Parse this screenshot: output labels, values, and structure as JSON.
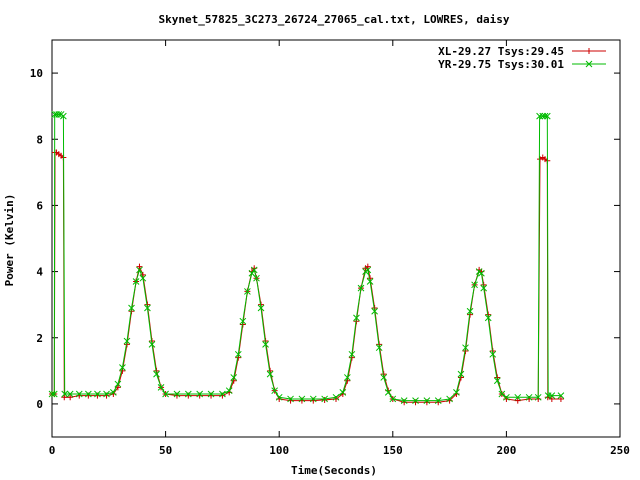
{
  "chart_data": {
    "type": "line",
    "title": "Skynet_57825_3C273_26724_27065_cal.txt, LOWRES, daisy",
    "xlabel": "Time(Seconds)",
    "ylabel": "Power (Kelvin)",
    "xlim": [
      0,
      250
    ],
    "ylim": [
      -1,
      11
    ],
    "xticks": [
      0,
      50,
      100,
      150,
      200,
      250
    ],
    "yticks": [
      0,
      2,
      4,
      6,
      8,
      10
    ],
    "grid": false,
    "legend_position": "top-right",
    "series": [
      {
        "name": "XL-29.27 Tsys:29.45",
        "color": "#cc0000",
        "marker": "plus",
        "points": [
          [
            0,
            0.3
          ],
          [
            1,
            0.3
          ],
          [
            1.3,
            7.6
          ],
          [
            2,
            7.6
          ],
          [
            3,
            7.55
          ],
          [
            4,
            7.5
          ],
          [
            5,
            7.45
          ],
          [
            5.4,
            0.2
          ],
          [
            8,
            0.2
          ],
          [
            12,
            0.25
          ],
          [
            16,
            0.25
          ],
          [
            20,
            0.25
          ],
          [
            24,
            0.25
          ],
          [
            27,
            0.3
          ],
          [
            29,
            0.5
          ],
          [
            31,
            1.0
          ],
          [
            33,
            1.8
          ],
          [
            35,
            2.8
          ],
          [
            37,
            3.7
          ],
          [
            38.5,
            4.15
          ],
          [
            40,
            3.9
          ],
          [
            42,
            3.0
          ],
          [
            44,
            1.9
          ],
          [
            46,
            1.0
          ],
          [
            48,
            0.5
          ],
          [
            50,
            0.3
          ],
          [
            55,
            0.25
          ],
          [
            60,
            0.25
          ],
          [
            65,
            0.25
          ],
          [
            70,
            0.25
          ],
          [
            75,
            0.25
          ],
          [
            78,
            0.35
          ],
          [
            80,
            0.7
          ],
          [
            82,
            1.4
          ],
          [
            84,
            2.4
          ],
          [
            86,
            3.4
          ],
          [
            88,
            4.0
          ],
          [
            89,
            4.1
          ],
          [
            90,
            3.8
          ],
          [
            92,
            3.0
          ],
          [
            94,
            1.9
          ],
          [
            96,
            1.0
          ],
          [
            98,
            0.4
          ],
          [
            100,
            0.15
          ],
          [
            105,
            0.1
          ],
          [
            110,
            0.1
          ],
          [
            115,
            0.1
          ],
          [
            120,
            0.12
          ],
          [
            125,
            0.15
          ],
          [
            128,
            0.3
          ],
          [
            130,
            0.7
          ],
          [
            132,
            1.4
          ],
          [
            134,
            2.5
          ],
          [
            136,
            3.5
          ],
          [
            138,
            4.1
          ],
          [
            139,
            4.15
          ],
          [
            140,
            3.8
          ],
          [
            142,
            2.9
          ],
          [
            144,
            1.8
          ],
          [
            146,
            0.9
          ],
          [
            148,
            0.4
          ],
          [
            150,
            0.15
          ],
          [
            155,
            0.05
          ],
          [
            160,
            0.05
          ],
          [
            165,
            0.05
          ],
          [
            170,
            0.05
          ],
          [
            175,
            0.1
          ],
          [
            178,
            0.3
          ],
          [
            180,
            0.8
          ],
          [
            182,
            1.6
          ],
          [
            184,
            2.7
          ],
          [
            186,
            3.6
          ],
          [
            188,
            4.05
          ],
          [
            189,
            4.0
          ],
          [
            190,
            3.6
          ],
          [
            192,
            2.7
          ],
          [
            194,
            1.6
          ],
          [
            196,
            0.8
          ],
          [
            198,
            0.3
          ],
          [
            200,
            0.15
          ],
          [
            205,
            0.1
          ],
          [
            210,
            0.15
          ],
          [
            214,
            0.15
          ],
          [
            214.8,
            7.4
          ],
          [
            216,
            7.45
          ],
          [
            217,
            7.4
          ],
          [
            218,
            7.35
          ],
          [
            218.2,
            0.2
          ],
          [
            220,
            0.15
          ],
          [
            224,
            0.15
          ]
        ]
      },
      {
        "name": "YR-29.75 Tsys:30.01",
        "color": "#00bb00",
        "marker": "cross",
        "points": [
          [
            0,
            0.3
          ],
          [
            1,
            0.3
          ],
          [
            1.2,
            8.75
          ],
          [
            2,
            8.75
          ],
          [
            3,
            8.75
          ],
          [
            4,
            8.75
          ],
          [
            5,
            8.7
          ],
          [
            5.6,
            0.3
          ],
          [
            8,
            0.3
          ],
          [
            12,
            0.3
          ],
          [
            16,
            0.3
          ],
          [
            20,
            0.3
          ],
          [
            24,
            0.3
          ],
          [
            27,
            0.35
          ],
          [
            29,
            0.6
          ],
          [
            31,
            1.1
          ],
          [
            33,
            1.9
          ],
          [
            35,
            2.9
          ],
          [
            37,
            3.7
          ],
          [
            38.5,
            4.05
          ],
          [
            40,
            3.8
          ],
          [
            42,
            2.9
          ],
          [
            44,
            1.8
          ],
          [
            46,
            0.9
          ],
          [
            48,
            0.5
          ],
          [
            50,
            0.3
          ],
          [
            55,
            0.3
          ],
          [
            60,
            0.3
          ],
          [
            65,
            0.3
          ],
          [
            70,
            0.3
          ],
          [
            75,
            0.3
          ],
          [
            78,
            0.4
          ],
          [
            80,
            0.8
          ],
          [
            82,
            1.5
          ],
          [
            84,
            2.5
          ],
          [
            86,
            3.4
          ],
          [
            88,
            3.95
          ],
          [
            89,
            4.05
          ],
          [
            90,
            3.8
          ],
          [
            92,
            2.9
          ],
          [
            94,
            1.8
          ],
          [
            96,
            0.9
          ],
          [
            98,
            0.4
          ],
          [
            100,
            0.2
          ],
          [
            105,
            0.15
          ],
          [
            110,
            0.15
          ],
          [
            115,
            0.15
          ],
          [
            120,
            0.15
          ],
          [
            125,
            0.2
          ],
          [
            128,
            0.35
          ],
          [
            130,
            0.8
          ],
          [
            132,
            1.5
          ],
          [
            134,
            2.6
          ],
          [
            136,
            3.5
          ],
          [
            138,
            4.0
          ],
          [
            139,
            4.05
          ],
          [
            140,
            3.7
          ],
          [
            142,
            2.8
          ],
          [
            144,
            1.7
          ],
          [
            146,
            0.8
          ],
          [
            148,
            0.35
          ],
          [
            150,
            0.15
          ],
          [
            155,
            0.1
          ],
          [
            160,
            0.1
          ],
          [
            165,
            0.1
          ],
          [
            170,
            0.1
          ],
          [
            175,
            0.15
          ],
          [
            178,
            0.35
          ],
          [
            180,
            0.9
          ],
          [
            182,
            1.7
          ],
          [
            184,
            2.8
          ],
          [
            186,
            3.6
          ],
          [
            188,
            4.0
          ],
          [
            189,
            3.95
          ],
          [
            190,
            3.5
          ],
          [
            192,
            2.6
          ],
          [
            194,
            1.5
          ],
          [
            196,
            0.7
          ],
          [
            198,
            0.3
          ],
          [
            200,
            0.2
          ],
          [
            205,
            0.2
          ],
          [
            210,
            0.2
          ],
          [
            214,
            0.2
          ],
          [
            214.6,
            8.7
          ],
          [
            216,
            8.7
          ],
          [
            217,
            8.7
          ],
          [
            218,
            8.7
          ],
          [
            218.4,
            0.25
          ],
          [
            220,
            0.25
          ],
          [
            224,
            0.25
          ]
        ]
      }
    ]
  }
}
